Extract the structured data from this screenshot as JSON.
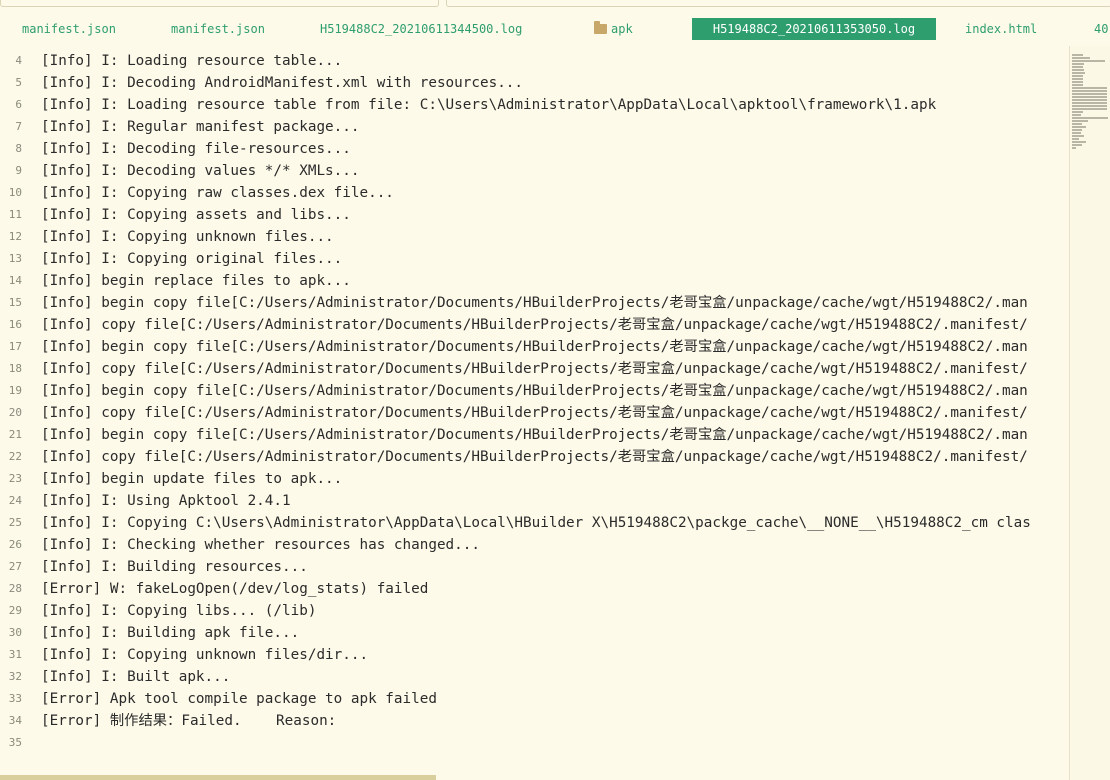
{
  "tabs": [
    {
      "label": "manifest.json",
      "type": "file",
      "active": false
    },
    {
      "label": "manifest.json",
      "type": "file",
      "active": false
    },
    {
      "label": "H519488C2_20210611344500.log",
      "type": "file",
      "active": false
    },
    {
      "label": "apk",
      "type": "folder",
      "active": false
    },
    {
      "label": "H519488C2_20210611353050.log",
      "type": "file",
      "active": true
    },
    {
      "label": "index.html",
      "type": "file",
      "active": false
    },
    {
      "label": "40",
      "type": "file",
      "active": false
    }
  ],
  "editor": {
    "lines": [
      {
        "num": "4",
        "text": "[Info] I: Loading resource table..."
      },
      {
        "num": "5",
        "text": "[Info] I: Decoding AndroidManifest.xml with resources..."
      },
      {
        "num": "6",
        "text": "[Info] I: Loading resource table from file: C:\\Users\\Administrator\\AppData\\Local\\apktool\\framework\\1.apk"
      },
      {
        "num": "7",
        "text": "[Info] I: Regular manifest package..."
      },
      {
        "num": "8",
        "text": "[Info] I: Decoding file-resources..."
      },
      {
        "num": "9",
        "text": "[Info] I: Decoding values */* XMLs..."
      },
      {
        "num": "10",
        "text": "[Info] I: Copying raw classes.dex file..."
      },
      {
        "num": "11",
        "text": "[Info] I: Copying assets and libs..."
      },
      {
        "num": "12",
        "text": "[Info] I: Copying unknown files..."
      },
      {
        "num": "13",
        "text": "[Info] I: Copying original files..."
      },
      {
        "num": "14",
        "text": "[Info] begin replace files to apk..."
      },
      {
        "num": "15",
        "text": "[Info] begin copy file[C:/Users/Administrator/Documents/HBuilderProjects/老哥宝盒/unpackage/cache/wgt/H519488C2/.man"
      },
      {
        "num": "16",
        "text": "[Info] copy file[C:/Users/Administrator/Documents/HBuilderProjects/老哥宝盒/unpackage/cache/wgt/H519488C2/.manifest/"
      },
      {
        "num": "17",
        "text": "[Info] begin copy file[C:/Users/Administrator/Documents/HBuilderProjects/老哥宝盒/unpackage/cache/wgt/H519488C2/.man"
      },
      {
        "num": "18",
        "text": "[Info] copy file[C:/Users/Administrator/Documents/HBuilderProjects/老哥宝盒/unpackage/cache/wgt/H519488C2/.manifest/"
      },
      {
        "num": "19",
        "text": "[Info] begin copy file[C:/Users/Administrator/Documents/HBuilderProjects/老哥宝盒/unpackage/cache/wgt/H519488C2/.man"
      },
      {
        "num": "20",
        "text": "[Info] copy file[C:/Users/Administrator/Documents/HBuilderProjects/老哥宝盒/unpackage/cache/wgt/H519488C2/.manifest/"
      },
      {
        "num": "21",
        "text": "[Info] begin copy file[C:/Users/Administrator/Documents/HBuilderProjects/老哥宝盒/unpackage/cache/wgt/H519488C2/.man"
      },
      {
        "num": "22",
        "text": "[Info] copy file[C:/Users/Administrator/Documents/HBuilderProjects/老哥宝盒/unpackage/cache/wgt/H519488C2/.manifest/"
      },
      {
        "num": "23",
        "text": "[Info] begin update files to apk..."
      },
      {
        "num": "24",
        "text": "[Info] I: Using Apktool 2.4.1"
      },
      {
        "num": "25",
        "text": "[Info] I: Copying C:\\Users\\Administrator\\AppData\\Local\\HBuilder X\\H519488C2\\packge_cache\\__NONE__\\H519488C2_cm clas"
      },
      {
        "num": "26",
        "text": "[Info] I: Checking whether resources has changed..."
      },
      {
        "num": "27",
        "text": "[Info] I: Building resources..."
      },
      {
        "num": "28",
        "text": "[Error] W: fakeLogOpen(/dev/log_stats) failed"
      },
      {
        "num": "29",
        "text": "[Info] I: Copying libs... (/lib)"
      },
      {
        "num": "30",
        "text": "[Info] I: Building apk file..."
      },
      {
        "num": "31",
        "text": "[Info] I: Copying unknown files/dir..."
      },
      {
        "num": "32",
        "text": "[Info] I: Built apk..."
      },
      {
        "num": "33",
        "text": "[Error] Apk tool compile package to apk failed"
      },
      {
        "num": "34",
        "text": "[Error] 制作结果：Failed.    Reason:"
      },
      {
        "num": "35",
        "text": ""
      }
    ]
  },
  "colors": {
    "background": "#fdfae9",
    "accent": "#2e9e6e",
    "text": "#2b2b2b",
    "line_number": "#8a8a7a"
  },
  "icons": {
    "folder_tab": "folder-icon"
  }
}
